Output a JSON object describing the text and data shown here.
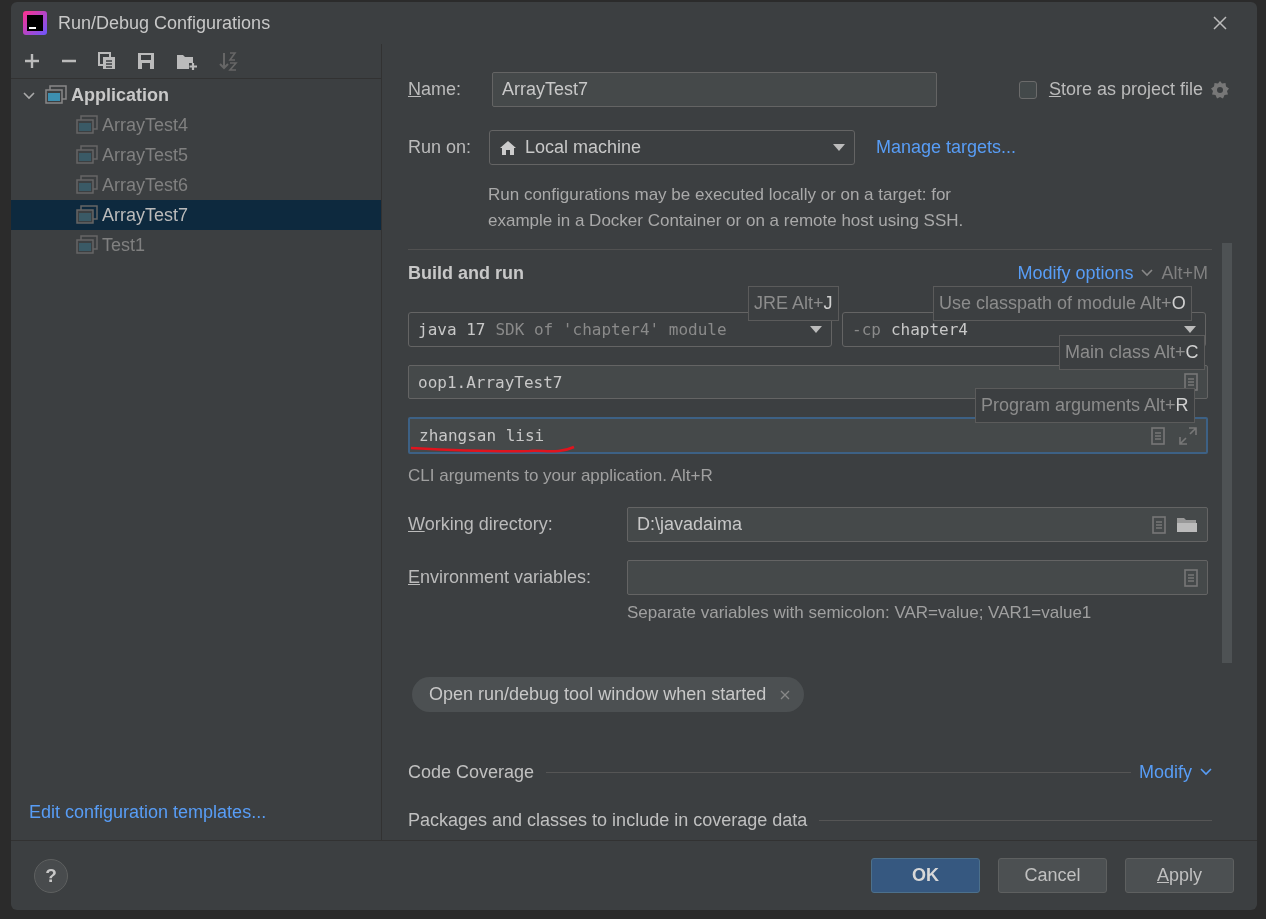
{
  "window": {
    "title": "Run/Debug Configurations"
  },
  "tree": [
    {
      "label": "Application",
      "expanded": true,
      "selected": false,
      "children": [
        {
          "label": "ArrayTest4",
          "selected": false,
          "dimmed": true
        },
        {
          "label": "ArrayTest5",
          "selected": false,
          "dimmed": true
        },
        {
          "label": "ArrayTest6",
          "selected": false,
          "dimmed": true
        },
        {
          "label": "ArrayTest7",
          "selected": true,
          "dimmed": false
        },
        {
          "label": "Test1",
          "selected": false,
          "dimmed": true
        }
      ]
    }
  ],
  "edit_templates_link": "Edit configuration templates...",
  "name": {
    "label": "Name:",
    "mnemonic": true,
    "value": "ArrayTest7"
  },
  "store_as_project_file": {
    "label": "Store as project file",
    "mnemonic": true,
    "checked": false
  },
  "run_on": {
    "label": "Run on:",
    "value": "Local machine"
  },
  "manage_targets": "Manage targets...",
  "run_on_note": [
    "Run configurations may be executed locally or on a target: for",
    "example in a Docker Container or on a remote host using SSH."
  ],
  "build_and_run": {
    "title": "Build and run",
    "modify_options": "Modify options",
    "modify_shortcut": "Alt+M",
    "jre": {
      "value": "java 17",
      "hint": "SDK of 'chapter4' module"
    },
    "classpath": {
      "prefix": "-cp",
      "value": "chapter4"
    },
    "main_class": "oop1.ArrayTest7",
    "program_arguments": {
      "value": "zhangsan lisi",
      "focused": true
    },
    "program_arguments_hint": "CLI arguments to your application. Alt+R",
    "working_directory": {
      "label": "Working directory:",
      "mnemonic": true,
      "value": "D:\\javadaima"
    },
    "environment_variables": {
      "label": "Environment variables:",
      "mnemonic": true
    },
    "environment_hint": "Separate variables with semicolon: VAR=value; VAR1=value1"
  },
  "hint_popups": [
    {
      "text": "JRE Alt+J",
      "kind": "jre"
    },
    {
      "text": "Use classpath of module Alt+O",
      "kind": "classpath"
    },
    {
      "text": "Main class Alt+C",
      "kind": "main"
    },
    {
      "text": "Program arguments Alt+R",
      "kind": "arguments"
    }
  ],
  "options": [
    {
      "label": "Open run/debug tool window when started",
      "removable": true
    }
  ],
  "sections": [
    {
      "title": "Code Coverage",
      "action": "Modify"
    },
    {
      "title": "Packages and classes to include in coverage data"
    }
  ],
  "help": "?",
  "buttons": [
    {
      "label": "OK",
      "kind": "primary",
      "mnemonic": false
    },
    {
      "label": "Cancel",
      "kind": "normal",
      "mnemonic": false
    },
    {
      "label": "Apply",
      "kind": "normal",
      "mnemonic": true
    }
  ]
}
